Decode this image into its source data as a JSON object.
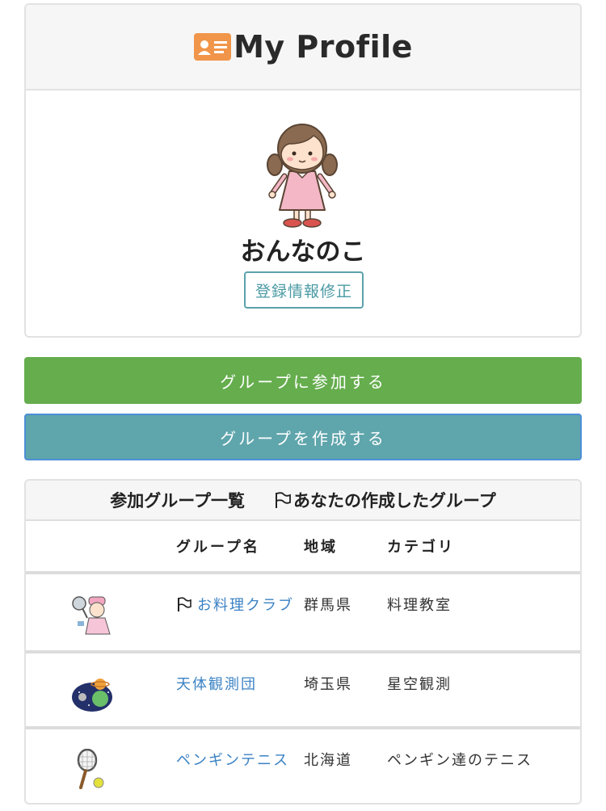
{
  "header": {
    "title": "My Profile",
    "icon": "id-card-icon"
  },
  "profile": {
    "name": "おんなのこ",
    "edit_label": "登録情報修正",
    "avatar": "girl-avatar"
  },
  "actions": {
    "join_label": "グループに参加する",
    "create_label": "グループを作成する"
  },
  "groups": {
    "title": "参加グループ一覧",
    "legend": "あなたの作成したグループ",
    "columns": [
      "グループ名",
      "地域",
      "カテゴリ"
    ],
    "rows": [
      {
        "name": "お料理クラブ",
        "area": "群馬県",
        "category": "料理教室",
        "owned": true,
        "thumb": "cook-thumbnail"
      },
      {
        "name": "天体観測団",
        "area": "埼玉県",
        "category": "星空観測",
        "owned": false,
        "thumb": "planet-thumbnail"
      },
      {
        "name": "ペンギンテニス",
        "area": "北海道",
        "category": "ペンギン達のテニス",
        "owned": false,
        "thumb": "tennis-racket-thumbnail"
      }
    ]
  },
  "colors": {
    "join": "#65ad4d",
    "create": "#5fa5ac",
    "link": "#3b82c4",
    "id_card": "#f0954a"
  }
}
